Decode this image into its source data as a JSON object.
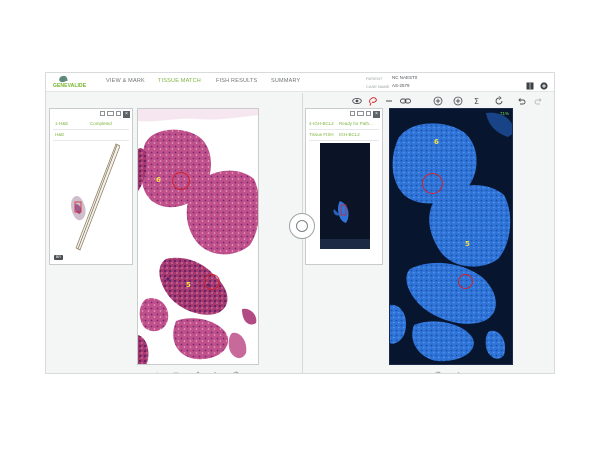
{
  "header": {
    "logo_text": "GENEVALIDE",
    "tabs": [
      {
        "label": "VIEW & MARK"
      },
      {
        "label": "TISSUE MATCH"
      },
      {
        "label": "FISH RESULTS"
      },
      {
        "label": "SUMMARY"
      }
    ],
    "active_tab": "TISSUE MATCH",
    "case_info": {
      "row1_label": "PATIENT",
      "row1_value": "NC NAEST0",
      "row2_label": "CASE NAME",
      "row2_value": "AS-2579"
    }
  },
  "colors": {
    "accent": "#7fb541",
    "he_stain": "#b2427c",
    "fish_blue": "#2f74d8",
    "marker_red": "#d3222a",
    "fish_bg": "#07152e"
  },
  "toolbar": {
    "icons": [
      "eye-icon",
      "lasso-icon",
      "minus-icon",
      "link-icon",
      "plus-icon",
      "zoom-in-icon",
      "zoom-fit-icon",
      "rotate-icon",
      "undo-icon",
      "redo-icon"
    ]
  },
  "left_card": {
    "line1_left": "1-H&E",
    "line1_right": "Completed",
    "line2": "H&E",
    "thumb_badge": "BR"
  },
  "right_card": {
    "line1_left": "4-IGH-BCL2",
    "line1_right": "Ready for Path...",
    "line2_left": "Tissue FISH",
    "line2_right": "IGH-BCL2"
  },
  "left_view": {
    "labels": [
      {
        "text": "6"
      },
      {
        "text": "5"
      }
    ]
  },
  "right_view": {
    "percent": "71%",
    "labels": [
      {
        "text": "6"
      },
      {
        "text": "5"
      }
    ]
  },
  "bottom_tools_left": [
    "hand-icon",
    "grab-icon",
    "pen-icon",
    "rotate-icon",
    "contrast-icon"
  ],
  "bottom_tools_right": [
    "contrast-icon",
    "check-icon"
  ]
}
